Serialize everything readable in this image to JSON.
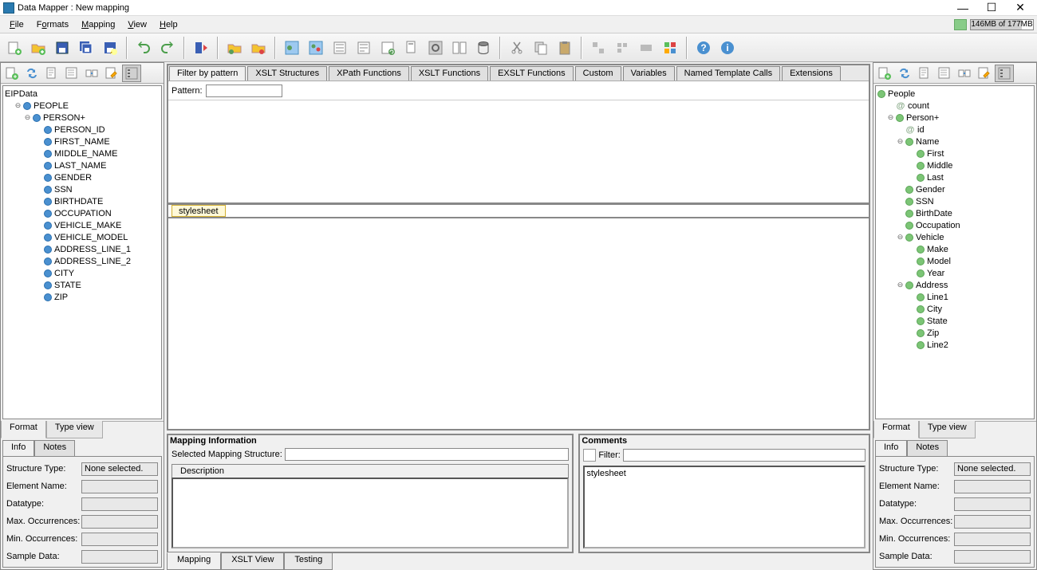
{
  "titlebar": {
    "title": "Data Mapper : New mapping"
  },
  "menu": [
    "File",
    "Formats",
    "Mapping",
    "View",
    "Help"
  ],
  "memory": {
    "text": "146MB of 177MB"
  },
  "left_tree": {
    "root": "EIPData",
    "level1": "PEOPLE",
    "level2": "PERSON+",
    "fields": [
      "PERSON_ID",
      "FIRST_NAME",
      "MIDDLE_NAME",
      "LAST_NAME",
      "GENDER",
      "SSN",
      "BIRTHDATE",
      "OCCUPATION",
      "VEHICLE_MAKE",
      "VEHICLE_MODEL",
      "ADDRESS_LINE_1",
      "ADDRESS_LINE_2",
      "CITY",
      "STATE",
      "ZIP"
    ]
  },
  "right_tree": {
    "root": "People",
    "attr1": "count",
    "person": "Person+",
    "id": "id",
    "name": {
      "label": "Name",
      "children": [
        "First",
        "Middle",
        "Last"
      ]
    },
    "simple": [
      "Gender",
      "SSN",
      "BirthDate",
      "Occupation"
    ],
    "vehicle": {
      "label": "Vehicle",
      "children": [
        "Make",
        "Model",
        "Year"
      ]
    },
    "address": {
      "label": "Address",
      "children": [
        "Line1",
        "City",
        "State",
        "Zip",
        "Line2"
      ]
    }
  },
  "side_tabs": {
    "format": "Format",
    "typeview": "Type view"
  },
  "info_tabs": {
    "info": "Info",
    "notes": "Notes"
  },
  "info_fields": {
    "structure_type": {
      "label": "Structure Type:",
      "value": "None selected."
    },
    "element_name": {
      "label": "Element Name:",
      "value": ""
    },
    "datatype": {
      "label": "Datatype:",
      "value": ""
    },
    "max_occ": {
      "label": "Max. Occurrences:",
      "value": ""
    },
    "min_occ": {
      "label": "Min. Occurrences:",
      "value": ""
    },
    "sample": {
      "label": "Sample Data:",
      "value": ""
    }
  },
  "center": {
    "tabs": [
      "Filter by pattern",
      "XSLT Structures",
      "XPath Functions",
      "XSLT Functions",
      "EXSLT Functions",
      "Custom",
      "Variables",
      "Named Template Calls",
      "Extensions"
    ],
    "pattern_label": "Pattern:",
    "stylesheet_tab": "stylesheet",
    "mapinfo": {
      "title": "Mapping Information",
      "selected_label": "Selected Mapping Structure:",
      "desc_tab": "Description"
    },
    "comments": {
      "title": "Comments",
      "filter_label": "Filter:",
      "body": "stylesheet"
    },
    "footer_tabs": [
      "Mapping",
      "XSLT View",
      "Testing"
    ]
  }
}
